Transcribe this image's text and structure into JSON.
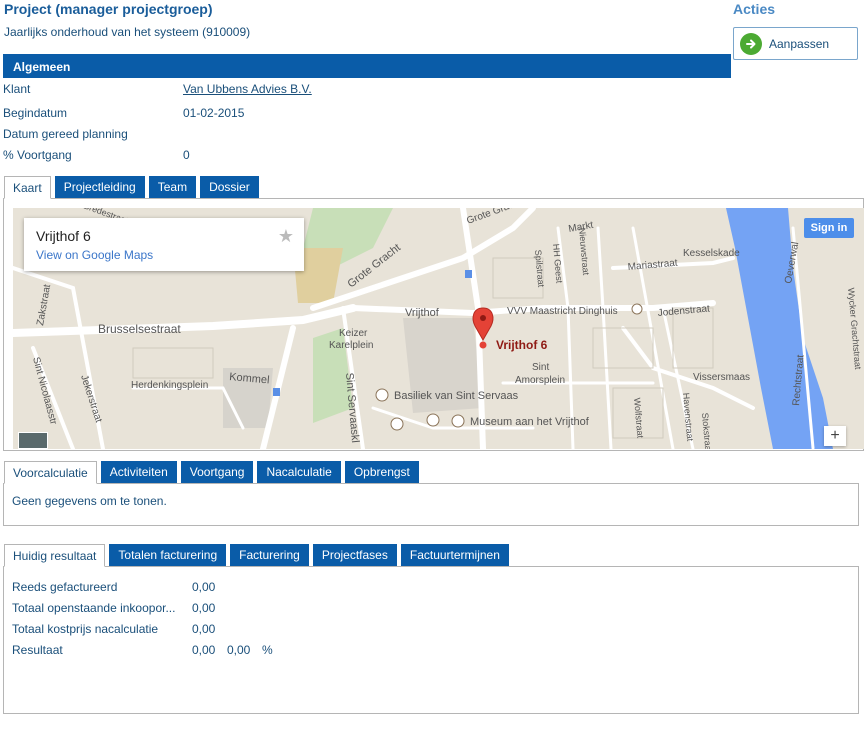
{
  "header": {
    "title": "Project (manager projectgroep)",
    "subtitle": "Jaarlijks onderhoud van het systeem (910009)"
  },
  "acties": {
    "title": "Acties",
    "button_label": "Aanpassen"
  },
  "algemeen": {
    "title": "Algemeen",
    "fields": [
      {
        "label": "Klant",
        "value": "Van Ubbens Advies B.V."
      },
      {
        "label": "Begindatum",
        "value": "01-02-2015"
      },
      {
        "label": "Datum gereed planning",
        "value": ""
      },
      {
        "label": "% Voortgang",
        "value": "0"
      }
    ]
  },
  "map_tabs": [
    "Kaart",
    "Projectleiding",
    "Team",
    "Dossier"
  ],
  "map": {
    "place_name": "Vrijthof 6",
    "view_link": "View on Google Maps",
    "signin": "Sign in",
    "zoom_plus": "+",
    "marker_label": "Vrijthof 6",
    "labels": {
      "grote_gracht_top": "Grote Gracht",
      "markt": "Markt",
      "kesselskade": "Kesselskade",
      "mariastraat": "Mariastraat",
      "grote_gracht": "Grote Gracht",
      "zakstraat": "Zakstraat",
      "brusselsestraat": "Brusselsestraat",
      "vrijthof": "Vrijthof",
      "vvv": "VVV Maastricht Dinghuis",
      "jodenstraat": "Jodenstraat",
      "keizer1": "Keizer",
      "keizer2": "Karelplein",
      "herdenkingsplein": "Herdenkingsplein",
      "kommel": "Kommel",
      "basiliek": "Basiliek van Sint Servaas",
      "museum": "Museum aan het Vrijthof",
      "sint_amorsplein1": "Sint",
      "sint_amorsplein2": "Amorsplein",
      "vissersmaas": "Vissersmaas",
      "sint_nicolaasstraat": "Sint Nicolaasstr",
      "jekerstraat": "Jekerstraat",
      "sint_servaasklooster": "Sint Servaaskl",
      "wolfstraat": "Wolfstraat",
      "havenstraat": "Havenstraat",
      "stokstraat": "Stokstraat",
      "rechtstraat": "Rechtstraat",
      "oeverwal": "Oeverwal",
      "hh_geest": "HH Geest",
      "nieuwstraat": "Nieuwstraat",
      "spilstraat": "Spilstraat",
      "wycker": "Wycker Grachtstraat",
      "bredestraat": "Bredestraat"
    }
  },
  "calc_tabs": [
    "Voorcalculatie",
    "Activiteiten",
    "Voortgang",
    "Nacalculatie",
    "Opbrengst"
  ],
  "calc_panel": {
    "empty_text": "Geen gegevens om te tonen."
  },
  "result_tabs": [
    "Huidig resultaat",
    "Totalen facturering",
    "Facturering",
    "Projectfases",
    "Factuurtermijnen"
  ],
  "result_panel": {
    "rows": [
      {
        "label": "Reeds gefactureerd",
        "value": "0,00"
      },
      {
        "label": "Totaal openstaande inkoopor...",
        "value": "0,00"
      },
      {
        "label": "Totaal kostprijs nacalculatie",
        "value": "0,00"
      },
      {
        "label": "Resultaat",
        "value": "0,00",
        "value2": "0,00",
        "unit": "%"
      }
    ]
  },
  "colors": {
    "primary": "#0a5ca8",
    "text": "#1a4f7a",
    "success": "#4caa33",
    "map_bg": "#e8e3d8",
    "river": "#74a3f4",
    "marker": "#e44236"
  }
}
